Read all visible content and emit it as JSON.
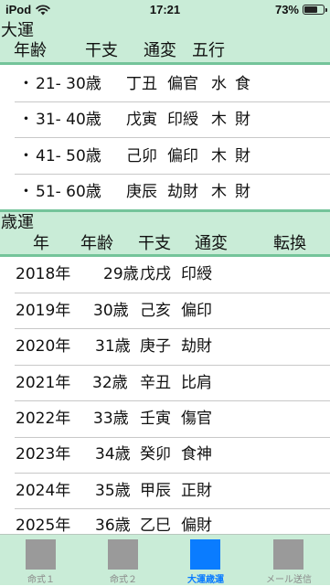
{
  "status": {
    "carrier": "iPod",
    "time": "17:21",
    "battery": "73%",
    "battery_level": 0.73
  },
  "taiun": {
    "title": "大運",
    "headers": {
      "age": "年齢",
      "kanshi": "干支",
      "tsuhen": "通変",
      "gogyo": "五行"
    },
    "rows": [
      {
        "bullet": "・",
        "age": "21- 30歳",
        "kanshi": "丁丑",
        "tsuhen": "偏官",
        "element": "水",
        "category": "食"
      },
      {
        "bullet": "・",
        "age": "31- 40歳",
        "kanshi": "戊寅",
        "tsuhen": "印綬",
        "element": "木",
        "category": "財"
      },
      {
        "bullet": "・",
        "age": "41- 50歳",
        "kanshi": "己卯",
        "tsuhen": "偏印",
        "element": "木",
        "category": "財"
      },
      {
        "bullet": "・",
        "age": "51- 60歳",
        "kanshi": "庚辰",
        "tsuhen": "劫財",
        "element": "木",
        "category": "財"
      }
    ]
  },
  "saiun": {
    "title": "歳運",
    "headers": {
      "year": "年",
      "age": "年齢",
      "kanshi": "干支",
      "tsuhen": "通変",
      "tenkan": "転換"
    },
    "rows": [
      {
        "year": "2018年",
        "age": "29歳",
        "kanshi": "戊戌",
        "tsuhen": "印綬"
      },
      {
        "year": "2019年",
        "age": "30歳",
        "kanshi": "己亥",
        "tsuhen": "偏印"
      },
      {
        "year": "2020年",
        "age": "31歳",
        "kanshi": "庚子",
        "tsuhen": "劫財"
      },
      {
        "year": "2021年",
        "age": "32歳",
        "kanshi": "辛丑",
        "tsuhen": "比肩"
      },
      {
        "year": "2022年",
        "age": "33歳",
        "kanshi": "壬寅",
        "tsuhen": "傷官"
      },
      {
        "year": "2023年",
        "age": "34歳",
        "kanshi": "癸卯",
        "tsuhen": "食神"
      },
      {
        "year": "2024年",
        "age": "35歳",
        "kanshi": "甲辰",
        "tsuhen": "正財"
      },
      {
        "year": "2025年",
        "age": "36歳",
        "kanshi": "乙巳",
        "tsuhen": "偏財"
      }
    ]
  },
  "tabs": [
    {
      "label": "命式１",
      "active": false
    },
    {
      "label": "命式２",
      "active": false
    },
    {
      "label": "大運歳運",
      "active": true
    },
    {
      "label": "メール送信",
      "active": false
    }
  ],
  "colors": {
    "header_bg": "#c9ecd7",
    "rule": "#74c49a",
    "active_tab": "#0a7cff",
    "inactive_tab": "#9a9a9a"
  }
}
